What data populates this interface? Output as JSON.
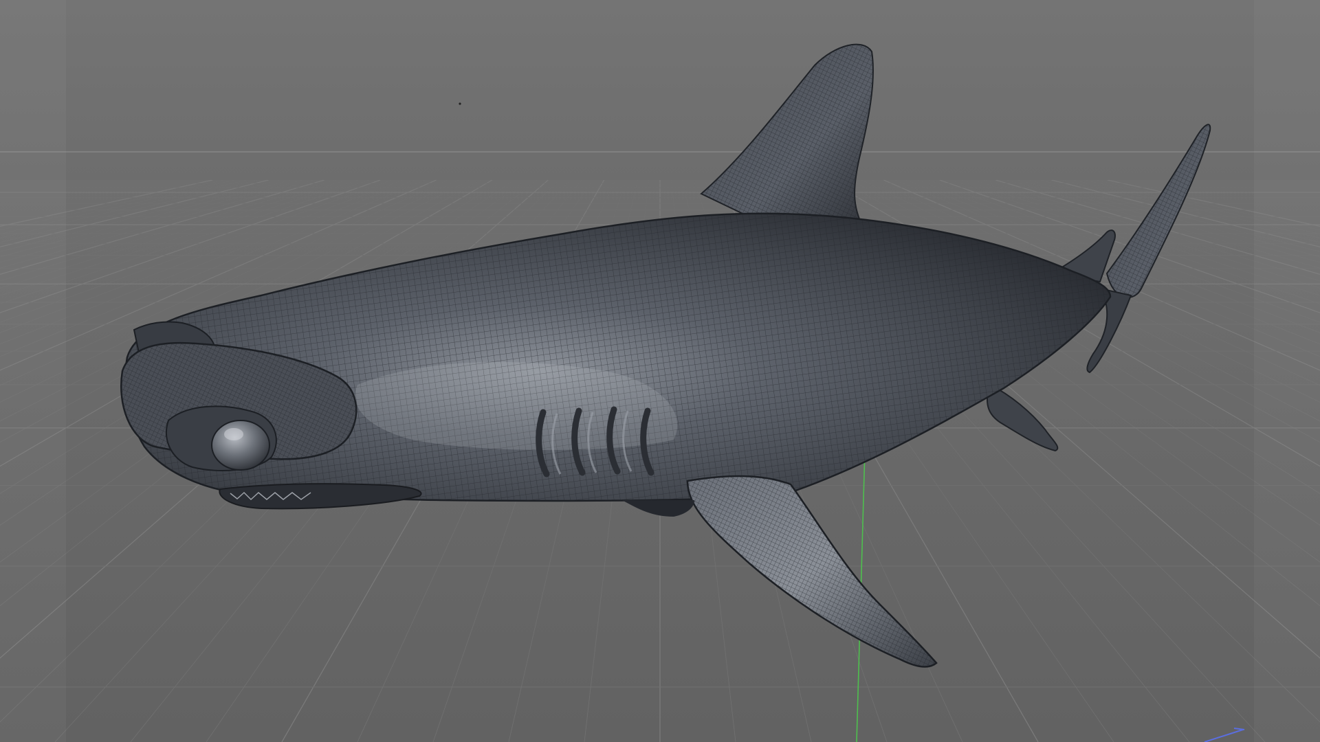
{
  "viewport": {
    "background_color": "#6b6b6b",
    "sky_color": "#727272",
    "floor_color": "#686868",
    "grid_line_color": "#7a7a7a",
    "grid_minor_color": "#707070",
    "horizon_color": "#858585"
  },
  "model": {
    "subject": "shark-mesh",
    "body_color": "#4b4f57",
    "wire_color": "#23262c",
    "highlight_color": "#c9ccd2",
    "shadow_color": "#25282e"
  },
  "axes": {
    "y_axis_color": "#4ec04e",
    "x_axis_color": "#5b6ee0",
    "gizmo_icon": "axis-gizmo-icon"
  }
}
